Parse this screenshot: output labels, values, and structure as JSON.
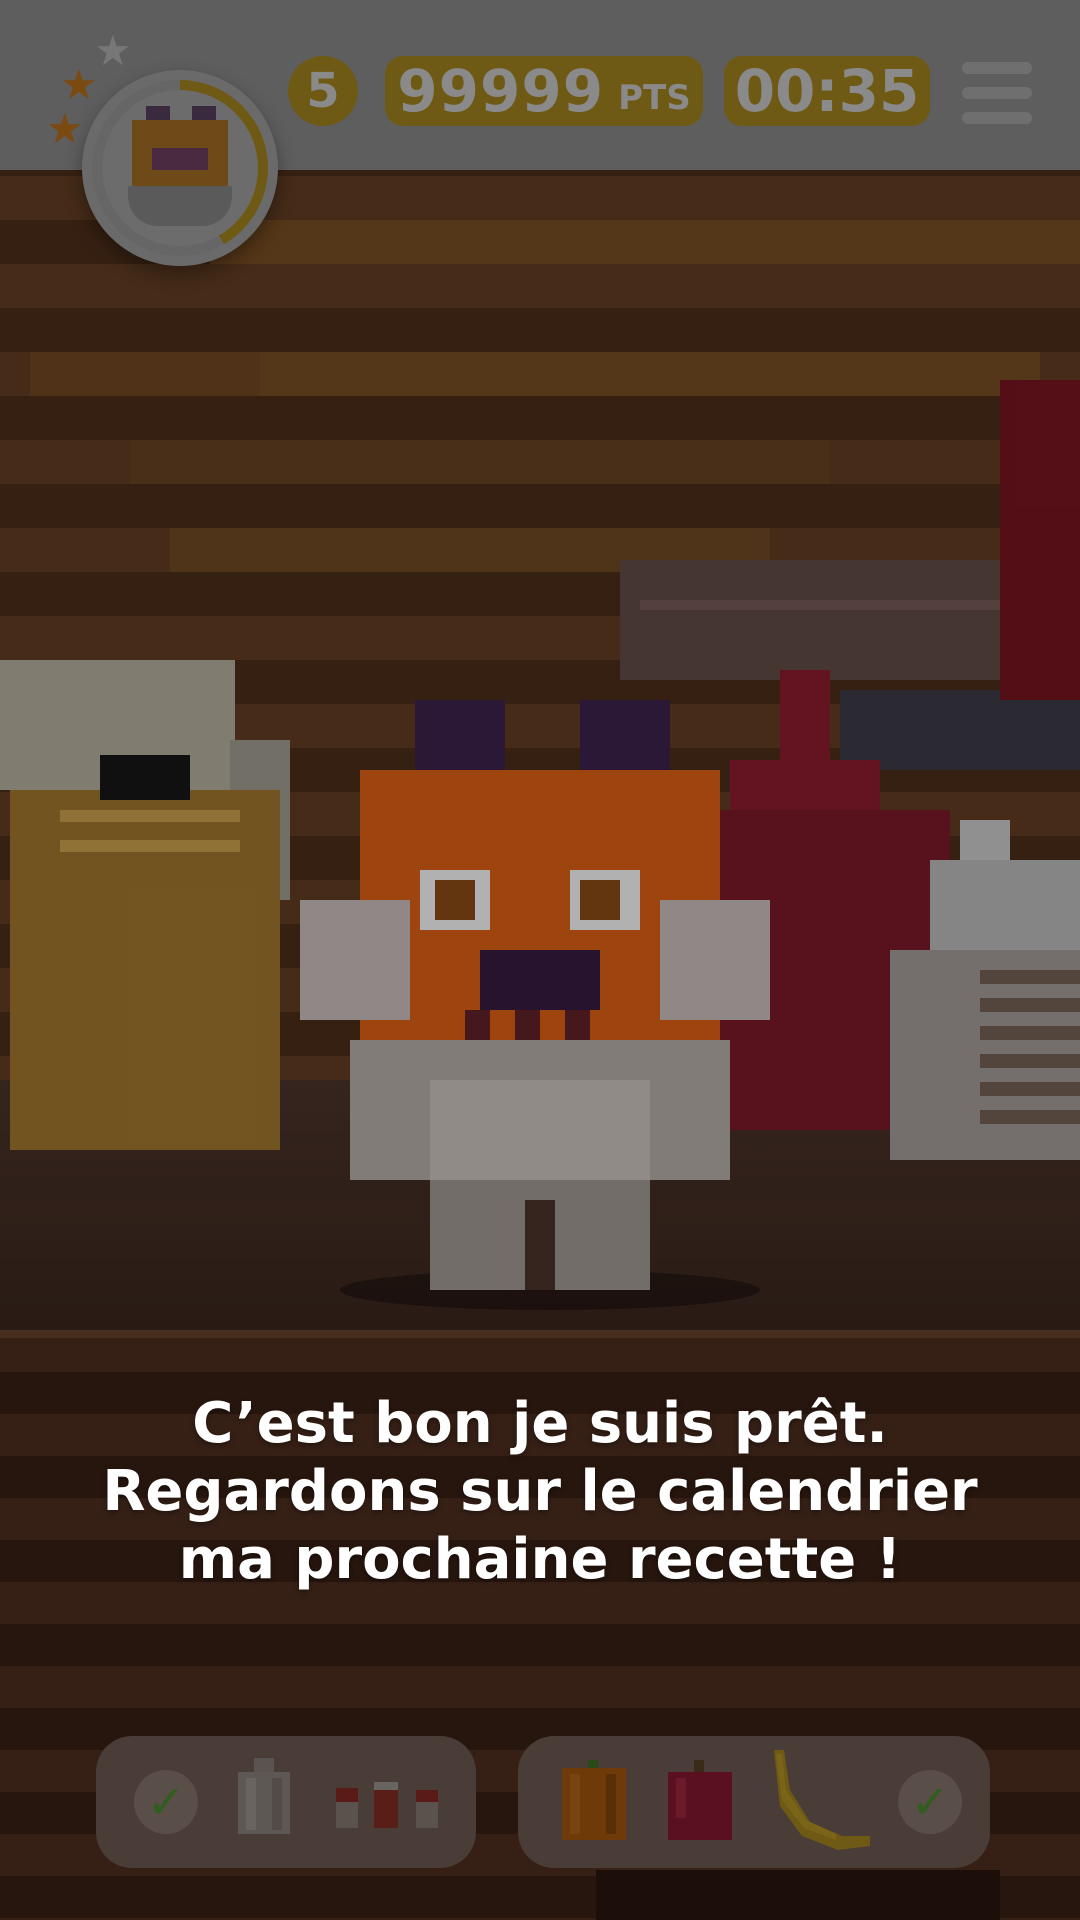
{
  "hud": {
    "level": "5",
    "score_value": "99999",
    "score_unit": "PTS",
    "timer": "00:35",
    "stars_earned": 2,
    "stars_total": 3
  },
  "dialog": {
    "lines": [
      "C’est bon je suis prêt.",
      "Regardons sur le calendrier",
      "ma prochaine recette !"
    ]
  },
  "trays": {
    "left": {
      "completed": true,
      "items": [
        "garlic-icon",
        "spice-jars-icon"
      ]
    },
    "right": {
      "completed": true,
      "items": [
        "orange-icon",
        "apple-icon",
        "banana-icon"
      ]
    }
  },
  "colors": {
    "accent_gold": "#F5B000",
    "check_green": "#3FA02A",
    "text": "#FFFFFF"
  }
}
